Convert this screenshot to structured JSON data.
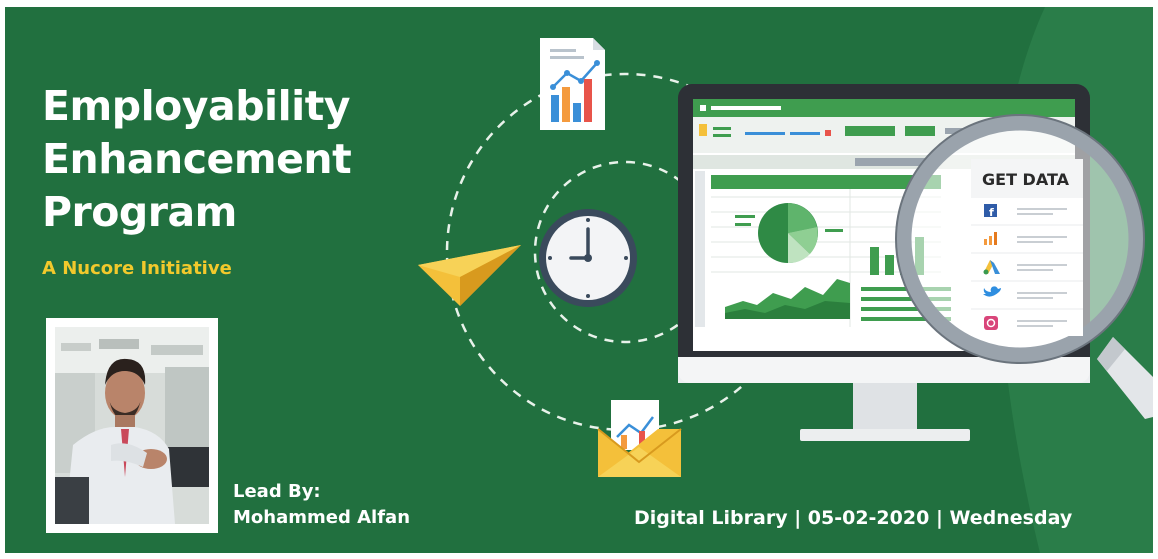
{
  "title": {
    "line1": "Employability",
    "line2": "Enhancement",
    "line3": "Program"
  },
  "subtitle": "A Nucore Initiative",
  "lead": {
    "label": "Lead By:",
    "name": "Mohammed Alfan"
  },
  "footer": {
    "location": "Digital Library",
    "separator": " | ",
    "date": "05-02-2020",
    "weekday": "Wednesday"
  },
  "panel": {
    "heading": "GET DATA",
    "sources": [
      "facebook-icon",
      "analytics-icon",
      "google-ads-icon",
      "twitter-icon",
      "instagram-icon"
    ]
  },
  "colors": {
    "background": "#21703f",
    "title": "#ffffff",
    "subtitle": "#f2c92c",
    "accent_yellow": "#f4c03a",
    "chart_green": "#3f9d4f"
  }
}
